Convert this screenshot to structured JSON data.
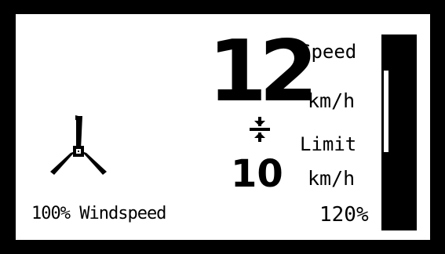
{
  "display": {
    "speed_value": "12",
    "speed_label": "Speed",
    "speed_unit": "km/h",
    "limit_label": "Limit",
    "limit_value": "10",
    "limit_unit": "km/h",
    "limit_percent": "120%",
    "windspeed_text": "100% Windspeed",
    "limit_ratio": 1.2,
    "icons": [
      "limit-arrows-icon",
      "wind-turbine-icon"
    ],
    "colors": {
      "background": "#000000",
      "panel": "#ffffff",
      "ink": "#000000"
    }
  }
}
